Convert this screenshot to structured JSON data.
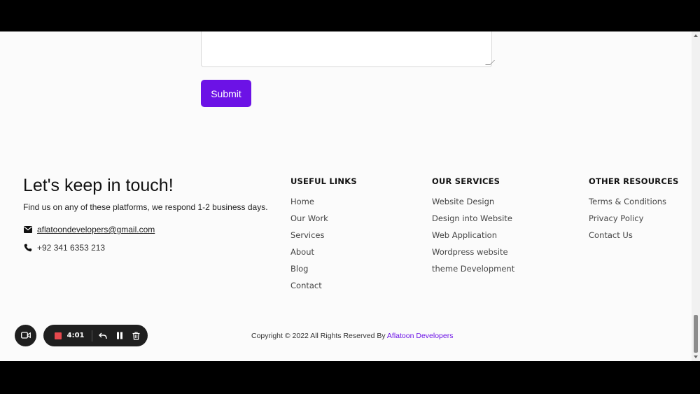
{
  "form": {
    "submit_label": "Submit"
  },
  "footer": {
    "contact": {
      "title": "Let's keep in touch!",
      "subtitle": "Find us on any of these platforms, we respond 1-2 business days.",
      "email": "aflatoondevelopers@gmail.com",
      "phone": "+92 341 6353 213",
      "email_icon": "envelope-icon",
      "phone_icon": "phone-icon"
    },
    "useful_links": {
      "heading": "USEFUL LINKS",
      "items": [
        "Home",
        "Our Work",
        "Services",
        "About",
        "Blog",
        "Contact"
      ]
    },
    "our_services": {
      "heading": "OUR SERVICES",
      "items": [
        "Website Design",
        "Design into Website",
        "Web Application",
        "Wordpress website",
        "theme Development"
      ]
    },
    "other_resources": {
      "heading": "OTHER RESOURCES",
      "items": [
        "Terms & Conditions",
        "Privacy Policy",
        "Contact Us"
      ]
    },
    "copyright": {
      "text": "Copyright © 2022 All Rights Reserved By ",
      "brand": "Aflatoon Developers"
    }
  },
  "recorder": {
    "time": "4:01",
    "icons": [
      "camera-icon",
      "stop-icon",
      "undo-icon",
      "pause-icon",
      "trash-icon"
    ]
  },
  "colors": {
    "accent": "#6c12e6",
    "recorder_bg": "#1f1f1f",
    "record_red": "#e5484d"
  }
}
